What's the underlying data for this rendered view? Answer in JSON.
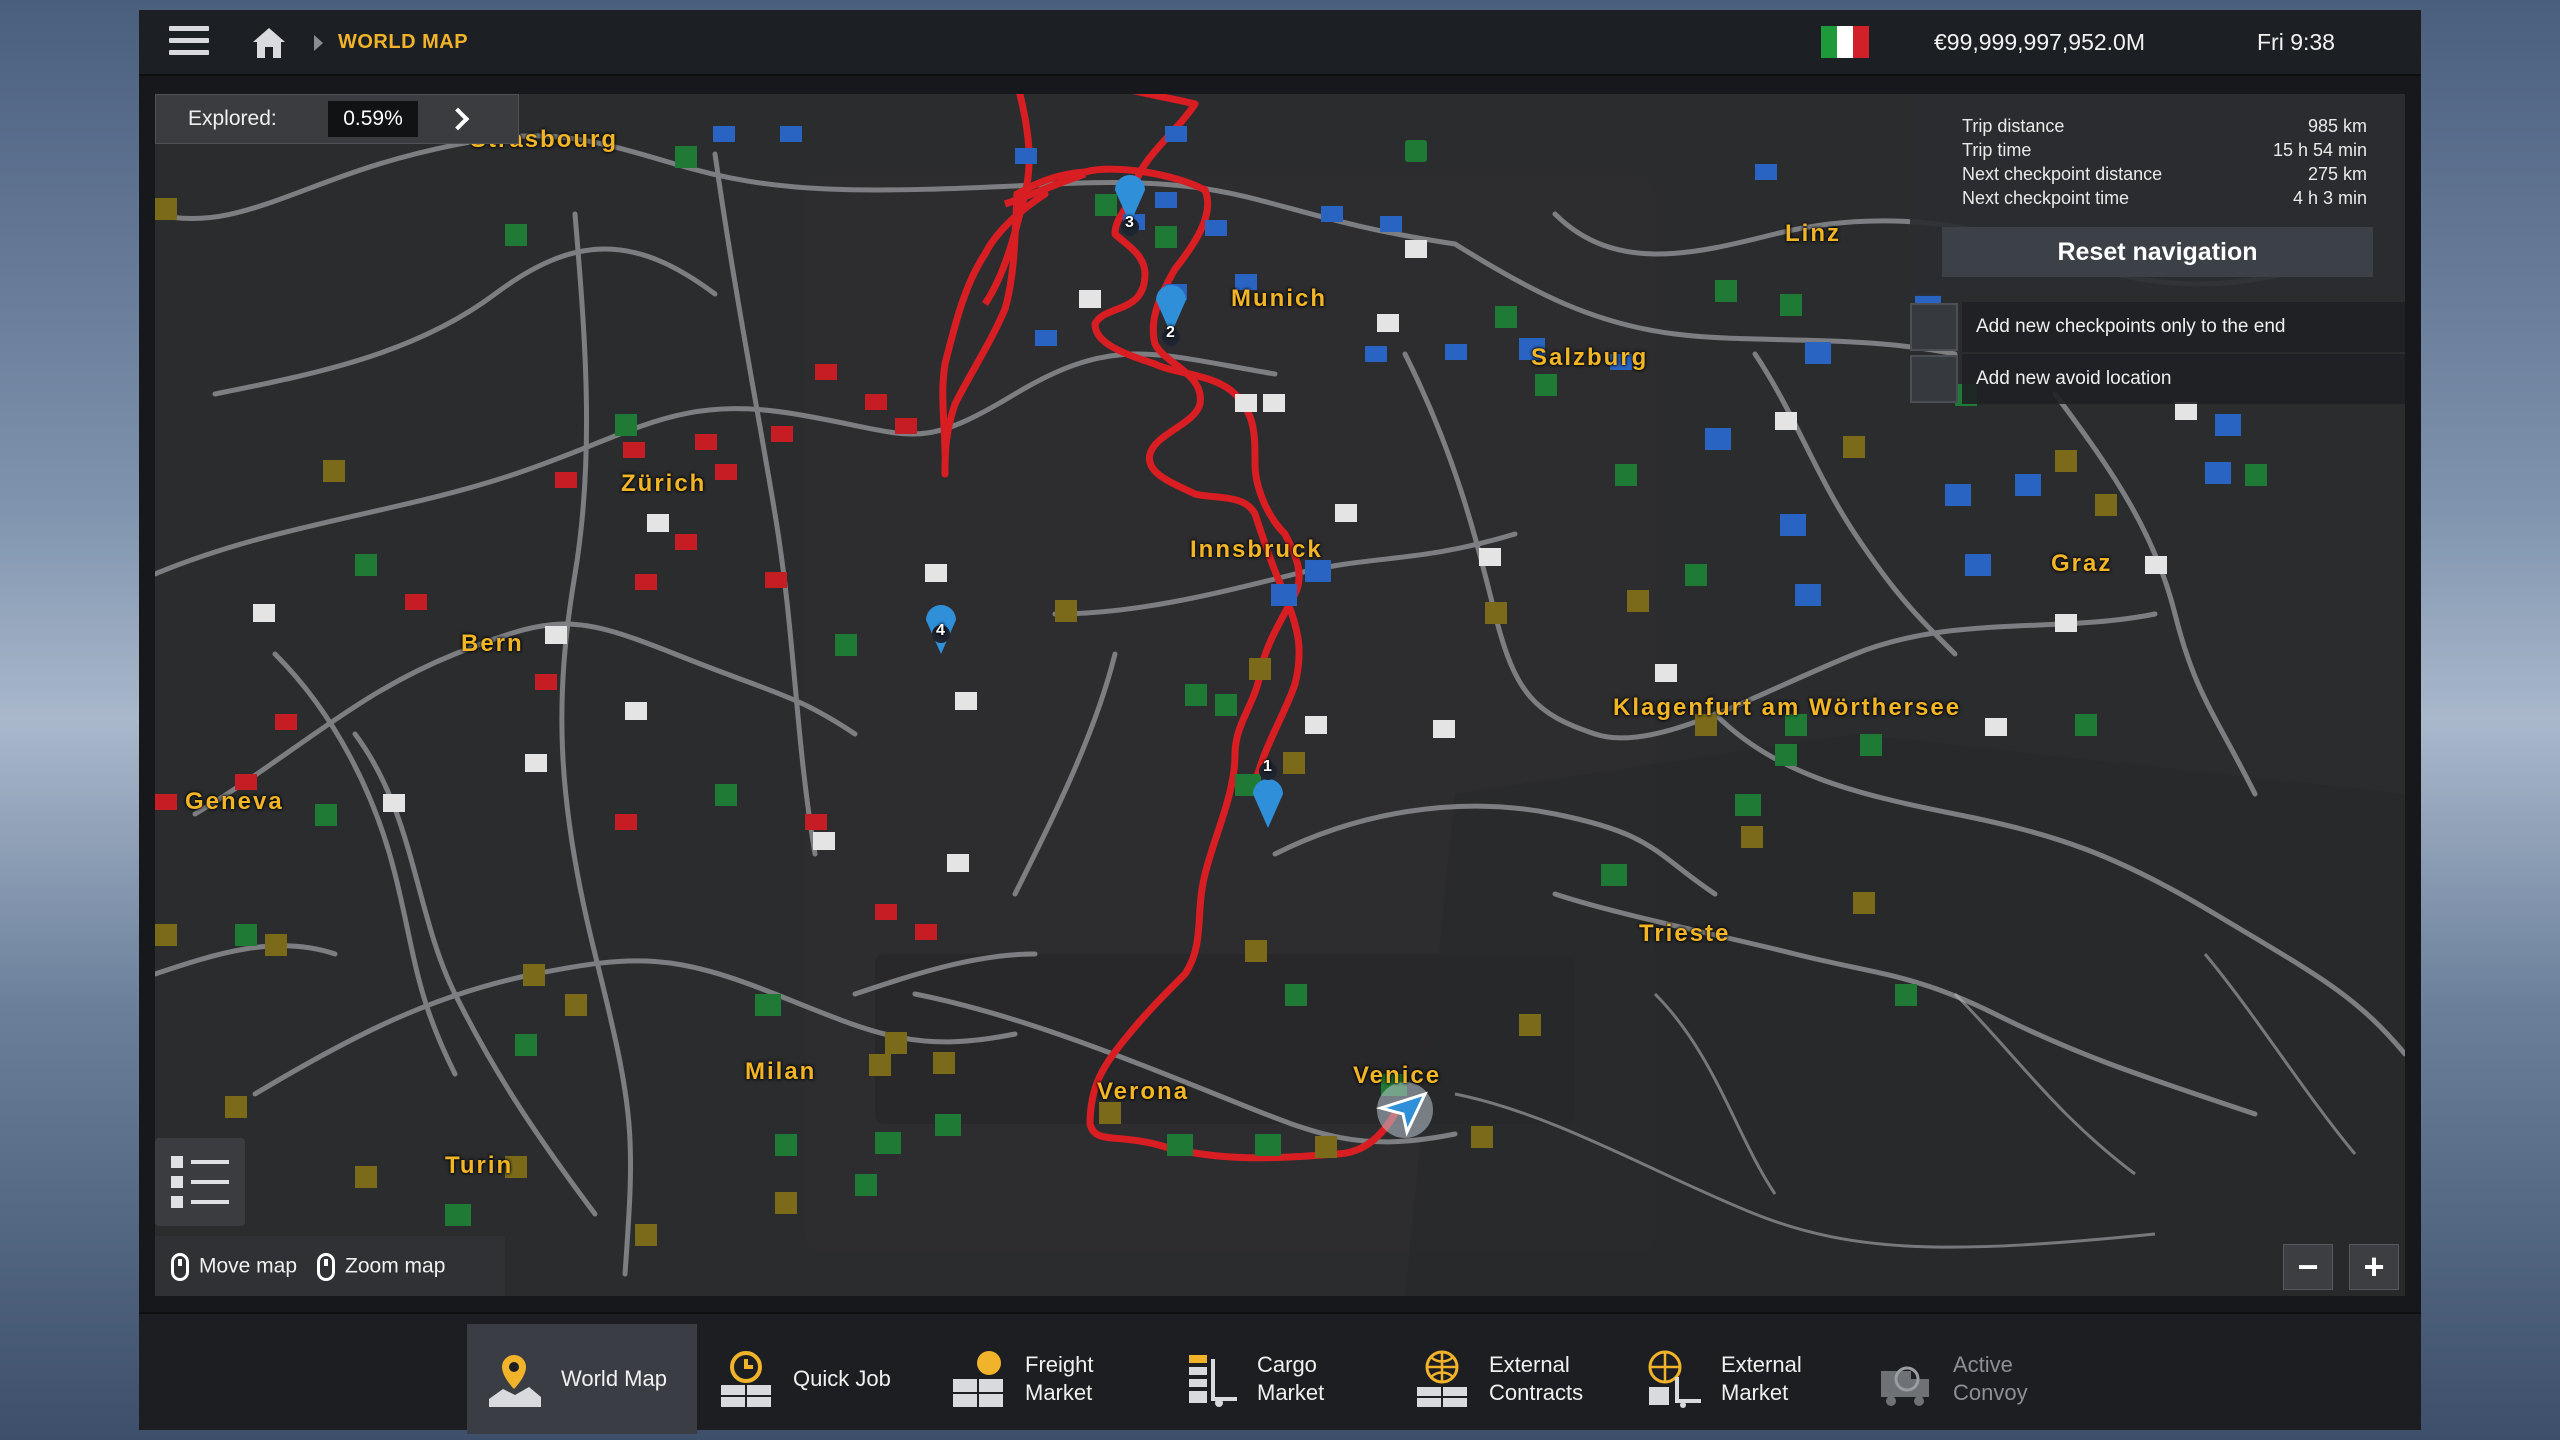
{
  "topbar": {
    "breadcrumb": "WORLD MAP",
    "money": "€99,999,997,952.0M",
    "time": "Fri 9:38",
    "flag_colors": [
      "#1f9a3b",
      "#ffffff",
      "#d2202a"
    ]
  },
  "explored": {
    "label": "Explored:",
    "value": "0.59%"
  },
  "trip": {
    "rows": [
      {
        "label": "Trip distance",
        "value": "985 km"
      },
      {
        "label": "Trip time",
        "value": "15 h 54 min"
      },
      {
        "label": "Next checkpoint distance",
        "value": "275 km"
      },
      {
        "label": "Next checkpoint time",
        "value": "4 h 3 min"
      }
    ],
    "reset_label": "Reset navigation"
  },
  "options": {
    "checkpoints_label": "Add new checkpoints only to the end",
    "avoid_label": "Add new avoid location"
  },
  "hints": {
    "move": "Move map",
    "zoom": "Zoom map"
  },
  "cities": [
    {
      "name": "Strasbourg"
    },
    {
      "name": "Munich"
    },
    {
      "name": "Linz"
    },
    {
      "name": "Salzburg"
    },
    {
      "name": "Zürich"
    },
    {
      "name": "Innsbruck"
    },
    {
      "name": "Graz"
    },
    {
      "name": "Bern"
    },
    {
      "name": "Klagenfurt am Wörthersee"
    },
    {
      "name": "Geneva"
    },
    {
      "name": "Trieste"
    },
    {
      "name": "Milan"
    },
    {
      "name": "Verona"
    },
    {
      "name": "Venice"
    },
    {
      "name": "Turin"
    }
  ],
  "checkpoints": [
    "1",
    "2",
    "3",
    "4"
  ],
  "nav_tabs": [
    {
      "label": "World Map",
      "icon": "world-map-icon"
    },
    {
      "label": "Quick Job",
      "icon": "quick-job-icon"
    },
    {
      "label": "Freight Market",
      "icon": "freight-market-icon"
    },
    {
      "label": "Cargo Market",
      "icon": "cargo-market-icon"
    },
    {
      "label": "External Contracts",
      "icon": "external-contracts-icon"
    },
    {
      "label": "External Market",
      "icon": "external-market-icon"
    },
    {
      "label": "Active Convoy",
      "icon": "active-convoy-icon"
    }
  ],
  "colors": {
    "accent": "#f1b32a",
    "route": "#d81e22",
    "road": "#8d8f93",
    "panel": "#1c1f23"
  }
}
